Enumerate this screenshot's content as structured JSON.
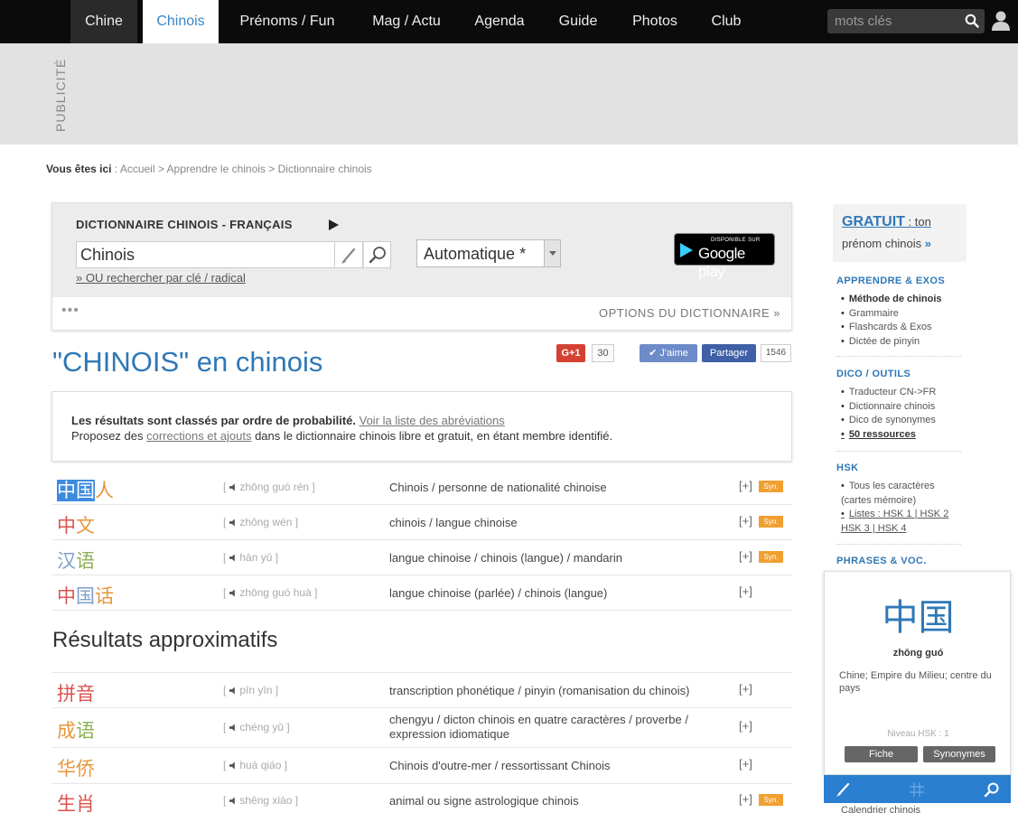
{
  "nav": {
    "tabs": [
      {
        "label": "Chine"
      },
      {
        "label": "Chinois"
      },
      {
        "label": "Prénoms / Fun"
      },
      {
        "label": "Mag / Actu"
      },
      {
        "label": "Agenda"
      },
      {
        "label": "Guide"
      },
      {
        "label": "Photos"
      },
      {
        "label": "Club"
      }
    ],
    "search_placeholder": "mots clés"
  },
  "ad": {
    "label": "PUBLICITÉ"
  },
  "breadcrumb": {
    "prefix": "Vous êtes ici",
    "items": [
      "Accueil",
      "Apprendre le chinois",
      "Dictionnaire chinois"
    ]
  },
  "dictionary": {
    "title": "DICTIONNAIRE CHINOIS - FRANÇAIS",
    "query": "Chinois",
    "radical_link": "» OU rechercher par clé / radical",
    "mode": "Automatique *",
    "store_small": "DISPONIBLE SUR",
    "store_big": "Google play",
    "more": "•••",
    "options": "OPTIONS DU DICTIONNAIRE »"
  },
  "result_heading": "\"CHINOIS\" en chinois",
  "social": {
    "gplus": "G+1",
    "gplus_count": "30",
    "like": "✔ J'aime",
    "share": "Partager",
    "share_count": "1546"
  },
  "info": {
    "bold": "Les résultats sont classés par ordre de probabilité.",
    "abbr_link": "Voir la liste des abréviations",
    "line2_a": "Proposez des ",
    "corr_link": "corrections et ajouts",
    "line2_b": " dans le dictionnaire chinois libre et gratuit, en étant membre identifié."
  },
  "results": [
    {
      "chars": [
        "中",
        "国",
        "人"
      ],
      "pinyin": "zhōng guó rén",
      "translation": "Chinois / personne de nationalité chinoise",
      "plus": "[+]",
      "syn": "Syn."
    },
    {
      "chars": [
        "中",
        "文"
      ],
      "pinyin": "zhōng wén",
      "translation": "chinois / langue chinoise",
      "plus": "[+]",
      "syn": "Syn."
    },
    {
      "chars": [
        "汉",
        "语"
      ],
      "pinyin": "hàn yǔ",
      "translation": "langue chinoise / chinois (langue) / mandarin",
      "plus": "[+]",
      "syn": "Syn."
    },
    {
      "chars": [
        "中",
        "国",
        "话"
      ],
      "pinyin": "zhōng guó huà",
      "translation": "langue chinoise (parlée) / chinois (langue)",
      "plus": "[+]",
      "syn": ""
    }
  ],
  "approx_heading": "Résultats approximatifs",
  "approx": [
    {
      "chars": [
        "拼",
        "音"
      ],
      "pinyin": "pīn yīn",
      "translation": "transcription phonétique / pinyin (romanisation du chinois)",
      "plus": "[+]",
      "syn": ""
    },
    {
      "chars": [
        "成",
        "语"
      ],
      "pinyin": "chéng yǔ",
      "translation": "chengyu / dicton chinois en quatre caractères / proverbe / expression idiomatique",
      "plus": "[+]",
      "syn": ""
    },
    {
      "chars": [
        "华",
        "侨"
      ],
      "pinyin": "huá qiáo",
      "translation": "Chinois d'outre-mer / ressortissant Chinois",
      "plus": "[+]",
      "syn": ""
    },
    {
      "chars": [
        "生",
        "肖"
      ],
      "pinyin": "shēng xiào",
      "translation": "animal ou signe astrologique chinois",
      "plus": "[+]",
      "syn": "Syn."
    }
  ],
  "sidebar": {
    "gratuit": "GRATUIT",
    "gratuit_rest": " : ton",
    "gratuit_line2": "prénom chinois",
    "gratuit_arrow": "»",
    "sections": [
      {
        "title": "APPRENDRE & EXOS",
        "items": [
          "Méthode de chinois",
          "Grammaire",
          "Flashcards & Exos",
          "Dictée de pinyin"
        ]
      },
      {
        "title": "DICO / OUTILS",
        "items": [
          "Traducteur CN->FR",
          "Dictionnaire chinois",
          "Dico de synonymes",
          "50 ressources"
        ]
      },
      {
        "title": "HSK",
        "items": [
          "Tous les caractères (cartes mémoire)",
          "Listes : HSK 1 | HSK 2 HSK 3 | HSK 4"
        ]
      },
      {
        "title": "PHRASES & VOC.",
        "items": []
      }
    ]
  },
  "card": {
    "hanzi": "中国",
    "pinyin": "zhōng guó",
    "definition": "Chine; Empire du Milieu; centre du pays",
    "hsk": "Niveau HSK : 1",
    "btn_fiche": "Fiche",
    "btn_syn": "Synonymes",
    "below": "Calendrier chinois"
  },
  "colors": {
    "accent": "#2f78b7",
    "nav_bg": "#0b0b0b",
    "toolbar": "#2a7fd0",
    "syn_badge": "#f0a030"
  }
}
